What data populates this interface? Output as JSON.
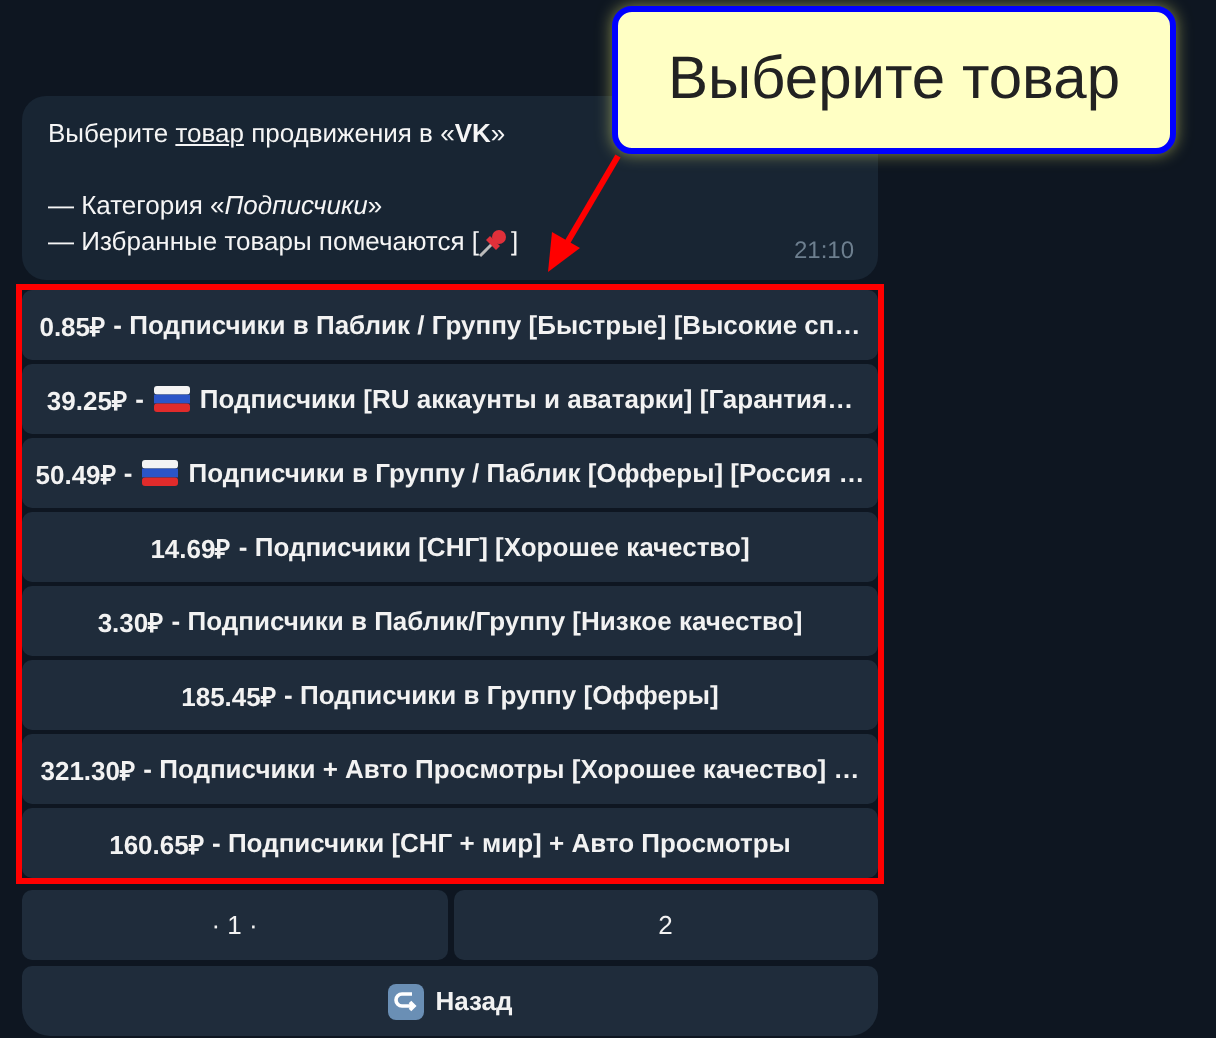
{
  "message": {
    "intro": {
      "before": "Выберите ",
      "link": "товар",
      "after": " продвижения в «**VK**»"
    },
    "category": "— Категория «*Подписчики*»",
    "favorites": {
      "before": "— Избранные товары помечаются [",
      "after": "]"
    },
    "time": "21:10"
  },
  "products": [
    {
      "price": "0.85₽",
      "separator": "-",
      "flag": false,
      "label": "Подписчики в Паблик / Группу [Быстрые] [Высокие сп…"
    },
    {
      "price": "39.25₽",
      "separator": "-",
      "flag": true,
      "label": "Подписчики [RU аккаунты и аватарки] [Гарантия…"
    },
    {
      "price": "50.49₽",
      "separator": "-",
      "flag": true,
      "label": "Подписчики в Группу / Паблик [Офферы] [Россия …"
    },
    {
      "price": "14.69₽",
      "separator": "-",
      "flag": false,
      "label": "Подписчики [СНГ] [Хорошее качество]"
    },
    {
      "price": "3.30₽",
      "separator": "-",
      "flag": false,
      "label": "Подписчики в Паблик/Группу [Низкое качество]"
    },
    {
      "price": "185.45₽",
      "separator": "-",
      "flag": false,
      "label": "Подписчики в Группу [Офферы]"
    },
    {
      "price": "321.30₽",
      "separator": "-",
      "flag": false,
      "label": "Подписчики + Авто Просмотры [Хорошее качество] …"
    },
    {
      "price": "160.65₽",
      "separator": "-",
      "flag": false,
      "label": "Подписчики [СНГ + мир] + Авто Просмотры"
    }
  ],
  "pages": [
    "· 1 ·",
    "2"
  ],
  "back": "Назад",
  "callout": "Выберите товар"
}
